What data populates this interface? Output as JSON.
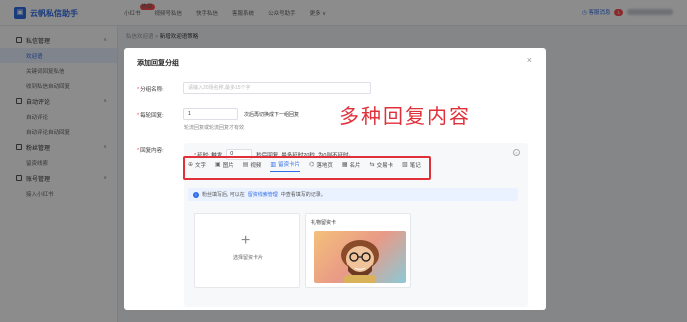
{
  "app": {
    "name": "云帆私信助手",
    "top_nav": [
      {
        "label": "小红书",
        "badge": "热销"
      },
      {
        "label": "视频号私信"
      },
      {
        "label": "快手私信"
      },
      {
        "label": "客服系统"
      },
      {
        "label": "公众号助手"
      },
      {
        "label": "更多 ∨"
      }
    ],
    "customer_service": "客服消息",
    "notify_count": "1"
  },
  "sidebar": {
    "groups": [
      {
        "label": "私信管理",
        "icon": "message-icon",
        "items": [
          "欢迎语",
          "关键词回复私信",
          "收到私信自动回复"
        ]
      },
      {
        "label": "自动评论",
        "icon": "comment-icon",
        "items": [
          "自动评论",
          "自动评论自动回复"
        ]
      },
      {
        "label": "粉丝管理",
        "icon": "fans-icon",
        "items": [
          "留资线索"
        ]
      },
      {
        "label": "账号管理",
        "icon": "account-icon",
        "items": [
          "接入小红书"
        ]
      }
    ],
    "active_item": "欢迎语"
  },
  "breadcrumb": {
    "parent": "私信欢迎语",
    "sep": ">",
    "current": "新增欢迎语策略"
  },
  "modal": {
    "title": "添加回复分组",
    "group_name_label": "分组名称:",
    "group_name_placeholder": "请输入20场名称,最多15个字",
    "per_round_label": "每轮回复:",
    "per_round_value": "1",
    "per_round_suffix": "次后再切换成下一组回复",
    "per_round_hint": "轮流回复或轮流回复才有效",
    "content_label": "回复内容:",
    "delay_prefix": "延时: 触发",
    "delay_value": "0",
    "delay_suffix": "秒后回复, 最多延时20秒, 为0则不延时。",
    "annotation": "多种回复内容",
    "type_tabs": [
      {
        "label": "文字",
        "icon": "text-icon",
        "glyph": "⊕"
      },
      {
        "label": "图片",
        "icon": "image-icon",
        "glyph": "▣"
      },
      {
        "label": "视频",
        "icon": "video-icon",
        "glyph": "▤"
      },
      {
        "label": "留资卡片",
        "icon": "card-icon",
        "glyph": "▥",
        "active": true
      },
      {
        "label": "落地页",
        "icon": "landing-page-icon",
        "glyph": "⌬"
      },
      {
        "label": "名片",
        "icon": "business-card-icon",
        "glyph": "▦"
      },
      {
        "label": "交易卡",
        "icon": "trade-card-icon",
        "glyph": "⇆"
      },
      {
        "label": "笔记",
        "icon": "note-icon",
        "glyph": "▧"
      }
    ],
    "info_prefix": "粉丝填写后, 可以在",
    "info_link": "留资线索管理",
    "info_suffix": "中查看填写的记录。",
    "add_card_label": "选择留资卡片",
    "message_card_title": "礼物留资卡"
  }
}
